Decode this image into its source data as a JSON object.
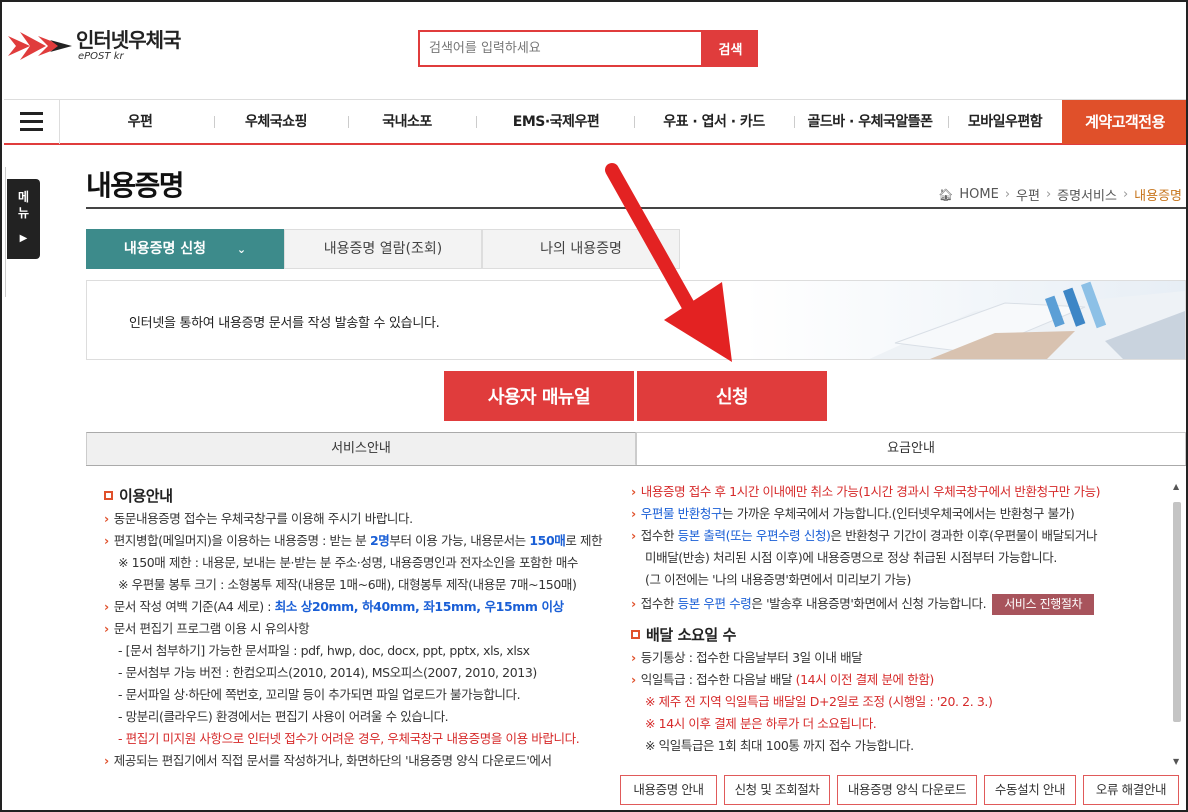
{
  "brand": {
    "name_ko": "인터넷우체국",
    "name_en": "ePOST kr"
  },
  "search": {
    "placeholder": "검색어를 입력하세요",
    "button": "검색"
  },
  "nav": {
    "items": [
      "우편",
      "우체국쇼핑",
      "국내소포",
      "EMS·국제우편",
      "우표 · 엽서 · 카드",
      "골드바 · 우체국알뜰폰",
      "모바일우편함"
    ],
    "special": "계약고객전용"
  },
  "side_menu": {
    "label": "메뉴"
  },
  "page": {
    "title": "내용증명"
  },
  "breadcrumb": {
    "home": "HOME",
    "items": [
      "우편",
      "증명서비스",
      "내용증명"
    ]
  },
  "tabs": [
    "내용증명 신청",
    "내용증명 열람(조회)",
    "나의 내용증명"
  ],
  "intro": {
    "text": "인터넷을 통하여 내용증명 문서를 작성 발송할 수 있습니다."
  },
  "actions": {
    "manual": "사용자 매뉴얼",
    "apply": "신청"
  },
  "service_tabs": [
    "서비스안내",
    "요금안내"
  ],
  "left": {
    "heading": "이용안내",
    "l1": "동문내용증명 접수는 우체국창구를 이용해 주시기 바랍니다.",
    "l2a": "편지병합(메일머지)을 이용하는 내용증명 : 받는 분 ",
    "l2b": "2명",
    "l2c": "부터 이용 가능, 내용문서는 ",
    "l2d": "150매",
    "l2e": "로 제한",
    "l3": "※ 150매 제한 : 내용문, 보내는 분·받는 분 주소·성명, 내용증명인과 전자소인을 포함한 매수",
    "l4": "※ 우편물 봉투 크기 : 소형봉투 제작(내용문 1매~6매), 대형봉투 제작(내용문 7매~150매)",
    "l5a": "문서 작성 여백 기준(A4 세로) : ",
    "l5b": "최소 상20mm, 하40mm, 좌15mm, 우15mm 이상",
    "l6": "문서 편집기 프로그램 이용 시 유의사항",
    "l7": "- [문서 첨부하기] 가능한 문서파일 : pdf, hwp, doc, docx, ppt, pptx, xls, xlsx",
    "l8": "- 문서첨부 가능 버전 : 한컴오피스(2010, 2014), MS오피스(2007, 2010, 2013)",
    "l9": "- 문서파일 상·하단에 쪽번호, 꼬리말 등이 추가되면 파일 업로드가 불가능합니다.",
    "l10": "- 망분리(클라우드) 환경에서는 편집기 사용이 어려울 수 있습니다.",
    "l11": "- 편집기 미지원 사항으로 인터넷 접수가 어려운 경우, 우체국창구 내용증명을 이용 바랍니다.",
    "l12": "제공되는 편집기에서 직접 문서를 작성하거나, 화면하단의 '내용증명 양식 다운로드'에서"
  },
  "right": {
    "r1": "내용증명 접수 후 1시간 이내에만 취소 가능(1시간 경과시 우체국창구에서 반환청구만 가능)",
    "r2a": "우편물 반환청구",
    "r2b": "는 가까운 우체국에서 가능합니다.(인터넷우체국에서는 반환청구 불가)",
    "r3a": "접수한 ",
    "r3b": "등본 출력(또는 우편수령 신청)",
    "r3c": "은 반환청구 기간이 경과한 이후(우편물이 배달되거나",
    "r4": "미배달(반송) 처리된 시점 이후)에 내용증명으로 정상 취급된 시점부터 가능합니다.",
    "r5": "(그 이전에는 '나의 내용증명'화면에서 미리보기 가능)",
    "r6a": "접수한 ",
    "r6b": "등본 우편 수령",
    "r6c": "은 '발송후 내용증명'화면에서 신청 가능합니다.",
    "r6btn": "서비스 진행절차",
    "heading2": "배달 소요일 수",
    "r7": "등기통상 : 접수한 다음날부터 3일 이내 배달",
    "r8a": "익일특급 : 접수한 다음날 배달 ",
    "r8b": "(14시 이전 결제 분에 한함)",
    "r9": "※ 제주 전 지역 익일특급 배달일 D+2일로 조정 (시행일 : '20. 2. 3.)",
    "r10": "※ 14시 이후 결제 분은 하루가 더 소요됩니다.",
    "r11": "※ 익일특급은 1회 최대 100통 까지 접수 가능합니다."
  },
  "footer_buttons": [
    "내용증명 안내",
    "신청 및 조회절차",
    "내용증명 양식 다운로드",
    "수동설치 안내",
    "오류 해결안내"
  ],
  "colors": {
    "accent_red": "#e03c3c",
    "tab_teal": "#3d8b8b",
    "special_orange": "#e0502a"
  }
}
